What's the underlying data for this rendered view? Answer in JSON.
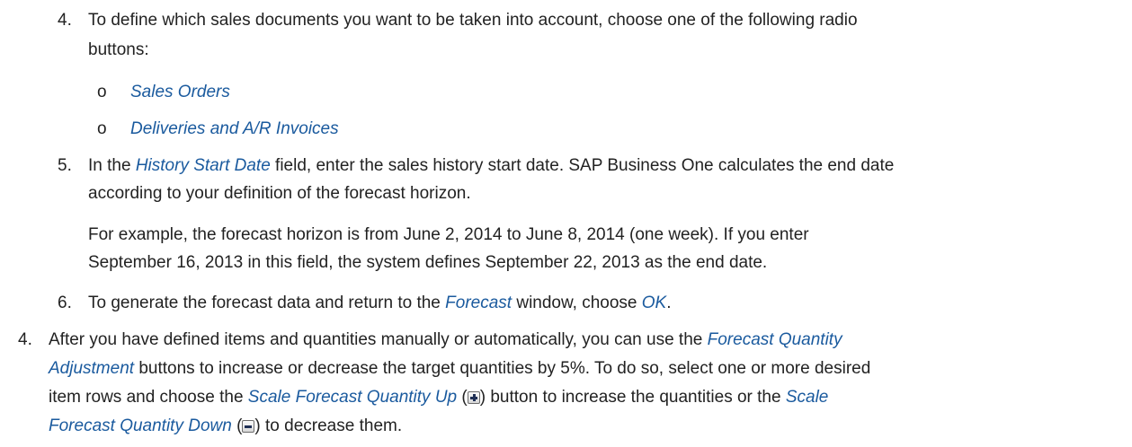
{
  "step4a": {
    "number": "4.",
    "line1": "To define which sales documents you want to be taken into account, choose one of the following radio",
    "line2": "buttons:",
    "options": [
      {
        "marker": "o",
        "label": "Sales Orders"
      },
      {
        "marker": "o",
        "label": "Deliveries and A/R Invoices"
      }
    ]
  },
  "step5": {
    "number": "5.",
    "l1_pre": "In the ",
    "l1_term": "History Start Date",
    "l1_post": " field, enter the sales history start date. SAP Business One calculates the end date",
    "line2": "according to your definition of the forecast horizon.",
    "example_line1": "For example, the forecast horizon is from June 2, 2014 to June 8, 2014 (one week). If you enter",
    "example_line2": "September 16, 2013 in this field, the system defines September 22, 2013 as the end date."
  },
  "step6": {
    "number": "6.",
    "pre": "To generate the forecast data and return to the ",
    "term1": "Forecast",
    "mid": " window, choose ",
    "term2": "OK",
    "post": "."
  },
  "step4b": {
    "number": "4.",
    "l1_pre": "After you have defined items and quantities manually or automatically, you can use the ",
    "l1_term": "Forecast Quantity",
    "l2_term": "Adjustment",
    "l2_post": " buttons to increase or decrease the target quantities by 5%. To do so, select one or more desired",
    "l3_pre": "item rows and choose the ",
    "l3_term1": "Scale Forecast Quantity Up",
    "l3_mid1": " (",
    "l3_mid2": ") button to increase the quantities or the ",
    "l3_term2": "Scale",
    "l4_term": "Forecast Quantity Down",
    "l4_mid": " (",
    "l4_post": ") to decrease them."
  }
}
